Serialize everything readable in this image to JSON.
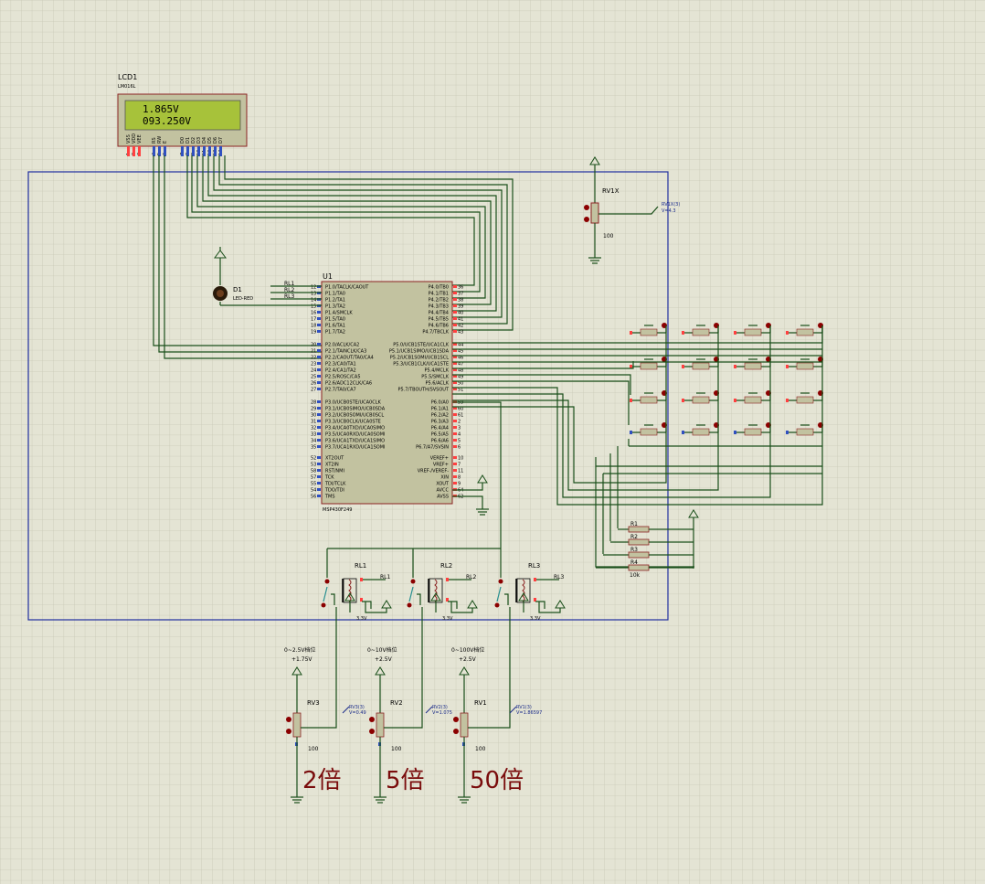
{
  "lcd": {
    "ref": "LCD1",
    "model": "LM016L",
    "line1": "1.865V",
    "line2": "093.250V",
    "pins": [
      "VSS",
      "VDD",
      "VEE",
      "RS",
      "RW",
      "E",
      "D0",
      "D1",
      "D2",
      "D3",
      "D4",
      "D5",
      "D6",
      "D7"
    ],
    "pin_numbers": [
      "1",
      "2",
      "3",
      "4",
      "5",
      "6",
      "7",
      "8",
      "9",
      "10",
      "11",
      "12",
      "13",
      "14"
    ]
  },
  "mcu": {
    "ref": "U1",
    "model": "MSP430F249",
    "left_pins": [
      {
        "num": "12",
        "name": "P1.0/TACLK/CAOUT"
      },
      {
        "num": "13",
        "name": "P1.1/TA0"
      },
      {
        "num": "14",
        "name": "P1.2/TA1"
      },
      {
        "num": "15",
        "name": "P1.3/TA2"
      },
      {
        "num": "16",
        "name": "P1.4/SMCLK"
      },
      {
        "num": "17",
        "name": "P1.5/TA0"
      },
      {
        "num": "18",
        "name": "P1.6/TA1"
      },
      {
        "num": "19",
        "name": "P1.7/TA2"
      },
      {
        "num": "20",
        "name": "P2.0/ACLK/CA2"
      },
      {
        "num": "21",
        "name": "P2.1/TAINCLK/CA3"
      },
      {
        "num": "22",
        "name": "P2.2/CAOUT/TA0/CA4"
      },
      {
        "num": "23",
        "name": "P2.3/CA0/TA1"
      },
      {
        "num": "24",
        "name": "P2.4/CA1/TA2"
      },
      {
        "num": "25",
        "name": "P2.5/ROSC/CA5"
      },
      {
        "num": "26",
        "name": "P2.6/ADC12CLK/CA6"
      },
      {
        "num": "27",
        "name": "P2.7/TA0/CA7"
      },
      {
        "num": "28",
        "name": "P3.0/UCB0STE/UCA0CLK"
      },
      {
        "num": "29",
        "name": "P3.1/UCB0SIMO/UCB0SDA"
      },
      {
        "num": "30",
        "name": "P3.2/UCB0SOMI/UCB0SCL"
      },
      {
        "num": "31",
        "name": "P3.3/UCB0CLK/UCA0STE"
      },
      {
        "num": "32",
        "name": "P3.4/UCA0TXD/UCA0SIMO"
      },
      {
        "num": "33",
        "name": "P3.5/UCA0RXD/UCA0SOMI"
      },
      {
        "num": "34",
        "name": "P3.6/UCA1TXD/UCA1SIMO"
      },
      {
        "num": "35",
        "name": "P3.7/UCA1RXD/UCA1SOMI"
      },
      {
        "num": "52",
        "name": "XT2OUT"
      },
      {
        "num": "53",
        "name": "XT2IN"
      },
      {
        "num": "58",
        "name": "RST/NMI"
      },
      {
        "num": "57",
        "name": "TCK"
      },
      {
        "num": "55",
        "name": "TDI/TCLK"
      },
      {
        "num": "54",
        "name": "TDO/TDI"
      },
      {
        "num": "56",
        "name": "TMS"
      }
    ],
    "right_pins": [
      {
        "num": "36",
        "name": "P4.0/TB0"
      },
      {
        "num": "37",
        "name": "P4.1/TB1"
      },
      {
        "num": "38",
        "name": "P4.2/TB2"
      },
      {
        "num": "39",
        "name": "P4.3/TB3"
      },
      {
        "num": "40",
        "name": "P4.4/TB4"
      },
      {
        "num": "41",
        "name": "P4.5/TB5"
      },
      {
        "num": "42",
        "name": "P4.6/TB6"
      },
      {
        "num": "43",
        "name": "P4.7/TBCLK"
      },
      {
        "num": "44",
        "name": "P5.0/UCB1STE/UCA1CLK"
      },
      {
        "num": "45",
        "name": "P5.1/UCB1SIMO/UCB1SDA"
      },
      {
        "num": "46",
        "name": "P5.2/UCB1SOMI/UCB1SCL"
      },
      {
        "num": "47",
        "name": "P5.3/UCB1CLK/UCA1STE"
      },
      {
        "num": "48",
        "name": "P5.4/MCLK"
      },
      {
        "num": "49",
        "name": "P5.5/SMCLK"
      },
      {
        "num": "50",
        "name": "P5.6/ACLK"
      },
      {
        "num": "51",
        "name": "P5.7/TBOUTH/SVSOUT"
      },
      {
        "num": "59",
        "name": "P6.0/A0"
      },
      {
        "num": "60",
        "name": "P6.1/A1"
      },
      {
        "num": "61",
        "name": "P6.2/A2"
      },
      {
        "num": "2",
        "name": "P6.3/A3"
      },
      {
        "num": "3",
        "name": "P6.4/A4"
      },
      {
        "num": "4",
        "name": "P6.5/A5"
      },
      {
        "num": "5",
        "name": "P6.6/A6"
      },
      {
        "num": "6",
        "name": "P6.7/A7/SVSIN"
      },
      {
        "num": "10",
        "name": "VEREF+"
      },
      {
        "num": "7",
        "name": "VREF+"
      },
      {
        "num": "11",
        "name": "VREF-/VEREF-"
      },
      {
        "num": "8",
        "name": "XIN"
      },
      {
        "num": "9",
        "name": "XOUT"
      },
      {
        "num": "64",
        "name": "AVCC"
      },
      {
        "num": "62",
        "name": "AVSS"
      }
    ]
  },
  "led": {
    "ref": "D1",
    "model": "LED-RED"
  },
  "net_labels": {
    "rl1": "RL1",
    "rl2": "RL2",
    "rl3": "RL3"
  },
  "pot_x": {
    "ref": "RV1X",
    "value": "100",
    "probe": "RV1X(3)",
    "probe_value": "V=4.3"
  },
  "relays": [
    {
      "ref": "RL1",
      "net": "RL1",
      "supply": "3.3V"
    },
    {
      "ref": "RL2",
      "net": "RL2",
      "supply": "3.3V"
    },
    {
      "ref": "RL3",
      "net": "RL3",
      "supply": "3.3V"
    }
  ],
  "pull_resistors": {
    "refs": [
      "R1",
      "R2",
      "R3",
      "R4"
    ],
    "value": "10k"
  },
  "pots": [
    {
      "ref": "RV3",
      "range": "0~2.5V档位",
      "supply": "+1.75V",
      "probe": "RV3(3)",
      "probe_value": "V=0.49",
      "value": "100",
      "gain": "2倍"
    },
    {
      "ref": "RV2",
      "range": "0~10V档位",
      "supply": "+2.5V",
      "probe": "RV2(3)",
      "probe_value": "V=1.075",
      "value": "100",
      "gain": "5倍"
    },
    {
      "ref": "RV1",
      "range": "0~100V档位",
      "supply": "+2.5V",
      "probe": "RV1(3)",
      "probe_value": "V=1.86597",
      "value": "100",
      "gain": "50倍"
    }
  ],
  "colors": {
    "background": "#e4e4d4",
    "grid": "#c9c9b6",
    "wire": "#1a4f1a",
    "frame": "#1f2fa0",
    "component_fill": "#c2c2a0",
    "lcd_screen": "#a7c23a",
    "text_red": "#7a0c0c"
  }
}
